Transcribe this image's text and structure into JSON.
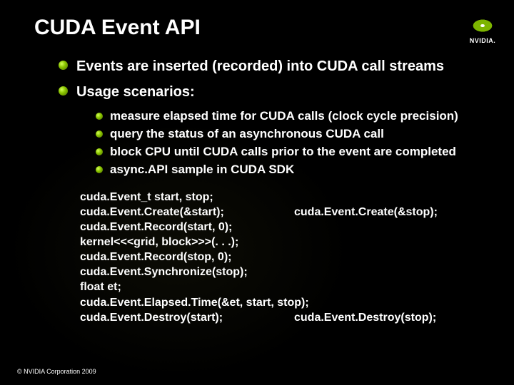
{
  "brand": {
    "name": "NVIDIA."
  },
  "title": "CUDA Event API",
  "bullets": {
    "main": [
      "Events are inserted (recorded) into CUDA call streams",
      "Usage scenarios:"
    ],
    "sub": [
      "measure elapsed time for CUDA calls (clock cycle precision)",
      "query the status of an asynchronous CUDA call",
      "block CPU until CUDA calls prior to the event are completed",
      "async.API sample in CUDA SDK"
    ]
  },
  "code": {
    "lines": [
      {
        "left": "cuda.Event_t start, stop;",
        "right": ""
      },
      {
        "left": "cuda.Event.Create(&start);",
        "right": "cuda.Event.Create(&stop);"
      },
      {
        "left": "cuda.Event.Record(start, 0);",
        "right": ""
      },
      {
        "left": "kernel<<<grid, block>>>(. . .);",
        "right": ""
      },
      {
        "left": "cuda.Event.Record(stop, 0);",
        "right": ""
      },
      {
        "left": "cuda.Event.Synchronize(stop);",
        "right": ""
      },
      {
        "left": "float et;",
        "right": ""
      },
      {
        "left": "cuda.Event.Elapsed.Time(&et, start, stop);",
        "right": ""
      },
      {
        "left": "cuda.Event.Destroy(start);",
        "right": "cuda.Event.Destroy(stop);"
      }
    ]
  },
  "copyright": "© NVIDIA Corporation 2009"
}
